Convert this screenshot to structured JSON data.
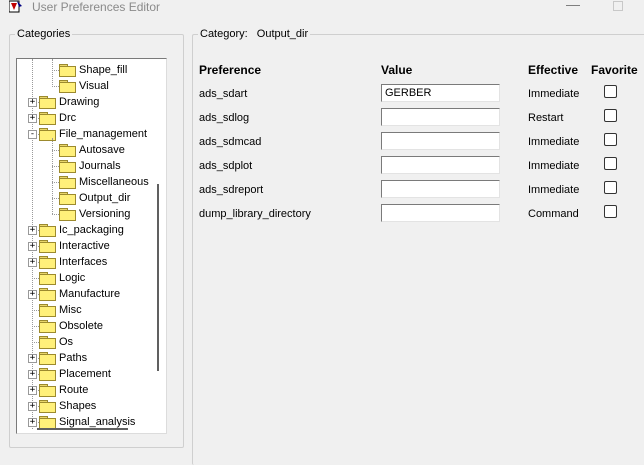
{
  "window": {
    "title": "User Preferences Editor"
  },
  "categories_panel": {
    "label": "Categories",
    "tree": [
      {
        "label": "Shape_fill",
        "level": 2
      },
      {
        "label": "Visual",
        "level": 2
      },
      {
        "label": "Drawing",
        "level": 1,
        "expander": "+"
      },
      {
        "label": "Drc",
        "level": 1,
        "expander": "+"
      },
      {
        "label": "File_management",
        "level": 1,
        "expander": "-"
      },
      {
        "label": "Autosave",
        "level": 2
      },
      {
        "label": "Journals",
        "level": 2
      },
      {
        "label": "Miscellaneous",
        "level": 2
      },
      {
        "label": "Output_dir",
        "level": 2,
        "selected": true
      },
      {
        "label": "Versioning",
        "level": 2
      },
      {
        "label": "Ic_packaging",
        "level": 1,
        "expander": "+"
      },
      {
        "label": "Interactive",
        "level": 1,
        "expander": "+"
      },
      {
        "label": "Interfaces",
        "level": 1,
        "expander": "+"
      },
      {
        "label": "Logic",
        "level": 1
      },
      {
        "label": "Manufacture",
        "level": 1,
        "expander": "+"
      },
      {
        "label": "Misc",
        "level": 1
      },
      {
        "label": "Obsolete",
        "level": 1
      },
      {
        "label": "Os",
        "level": 1
      },
      {
        "label": "Paths",
        "level": 1,
        "expander": "+"
      },
      {
        "label": "Placement",
        "level": 1,
        "expander": "+"
      },
      {
        "label": "Route",
        "level": 1,
        "expander": "+"
      },
      {
        "label": "Shapes",
        "level": 1,
        "expander": "+"
      },
      {
        "label": "Signal_analysis",
        "level": 1,
        "expander": "+"
      }
    ]
  },
  "category_panel": {
    "label": "Category:",
    "name": "Output_dir",
    "headers": {
      "preference": "Preference",
      "value": "Value",
      "effective": "Effective",
      "favorite": "Favorite"
    },
    "rows": [
      {
        "preference": "ads_sdart",
        "value": "GERBER",
        "effective": "Immediate",
        "favorite": false
      },
      {
        "preference": "ads_sdlog",
        "value": "",
        "effective": "Restart",
        "favorite": false
      },
      {
        "preference": "ads_sdmcad",
        "value": "",
        "effective": "Immediate",
        "favorite": false
      },
      {
        "preference": "ads_sdplot",
        "value": "",
        "effective": "Immediate",
        "favorite": false
      },
      {
        "preference": "ads_sdreport",
        "value": "",
        "effective": "Immediate",
        "favorite": false
      },
      {
        "preference": "dump_library_directory",
        "value": "",
        "effective": "Command",
        "favorite": false
      }
    ]
  }
}
